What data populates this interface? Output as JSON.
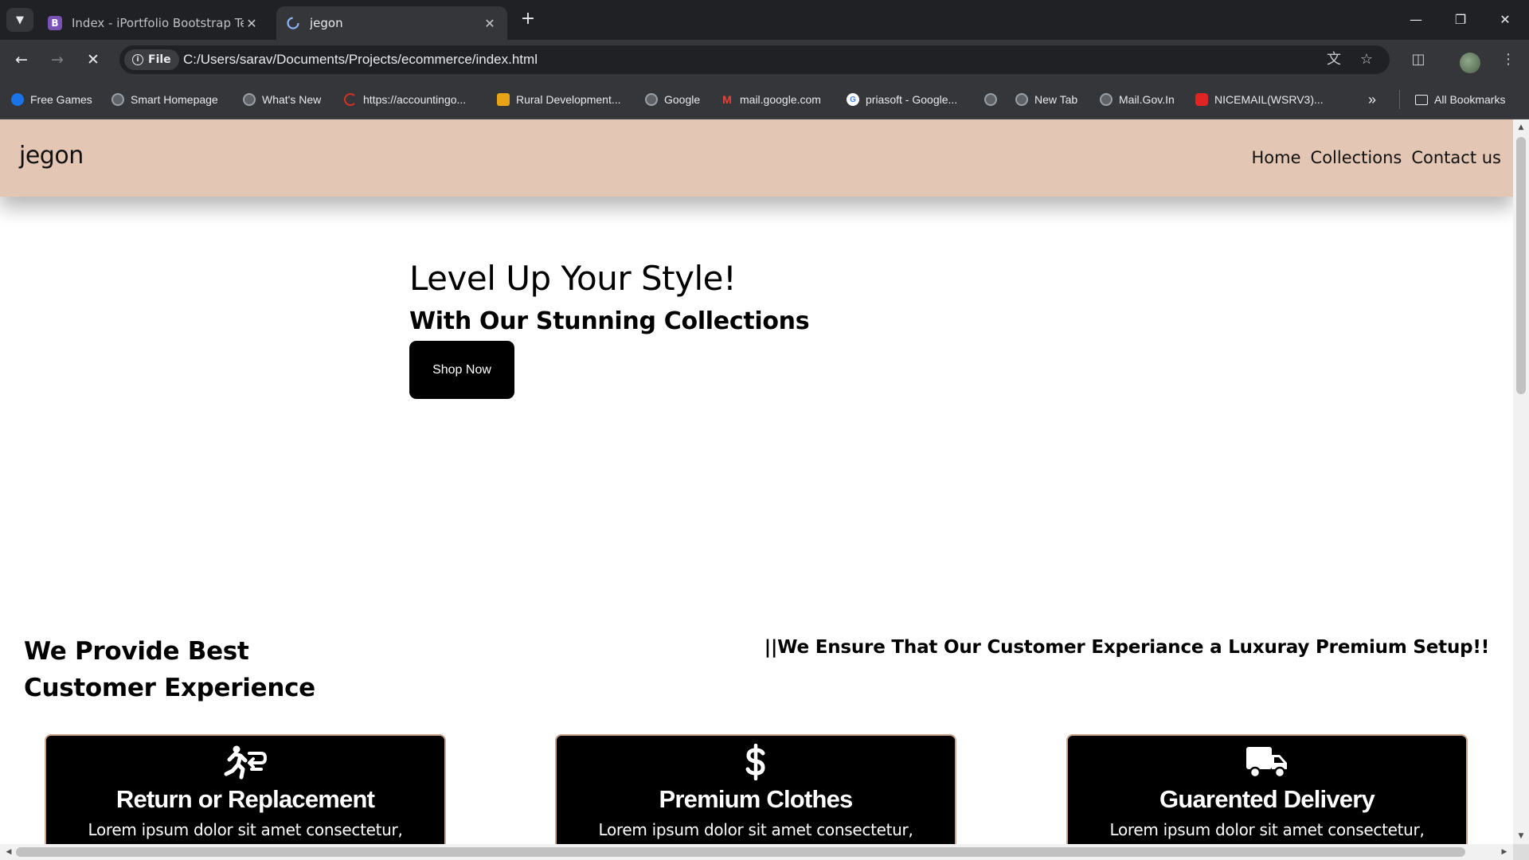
{
  "browser": {
    "tabs": [
      {
        "title": "Index - iPortfolio Bootstrap Template",
        "favicon": "bootstrap-icon",
        "favicon_letter": "B",
        "favicon_color": "#7952b3",
        "active": false
      },
      {
        "title": "jegon",
        "favicon": "loading-icon",
        "active": true
      }
    ],
    "omnibox": {
      "chip": "File",
      "url": "C:/Users/sarav/Documents/Projects/ecommerce/index.html"
    },
    "bookmarks": [
      {
        "label": "Free Games",
        "icon": "free-games-icon"
      },
      {
        "label": "Smart Homepage",
        "icon": "globe-icon"
      },
      {
        "label": "What's New",
        "icon": "globe-icon"
      },
      {
        "label": "https://accountingo...",
        "icon": "accounting-icon"
      },
      {
        "label": "Rural Development...",
        "icon": "rural-icon"
      },
      {
        "label": "Google",
        "icon": "globe-icon"
      },
      {
        "label": "mail.google.com",
        "icon": "gmail-icon"
      },
      {
        "label": "priasoft - Google...",
        "icon": "google-icon"
      },
      {
        "label": "",
        "icon": "globe-icon"
      },
      {
        "label": "New Tab",
        "icon": "globe-icon"
      },
      {
        "label": "Mail.Gov.In",
        "icon": "globe-icon"
      },
      {
        "label": "NICEMAIL(WSRV3)...",
        "icon": "nicemail-icon"
      }
    ],
    "all_bookmarks": "All Bookmarks"
  },
  "site": {
    "brand": "jegon",
    "nav": [
      "Home",
      "Collections",
      "Contact us"
    ],
    "hero": {
      "title": "Level Up Your Style!",
      "subtitle": "With Our Stunning Collections",
      "cta": "Shop Now"
    },
    "provide_heading": "We Provide Best Customer Experience",
    "ensure_text": "||We Ensure That Our Customer Experiance a Luxuray Premium Setup!!",
    "features": [
      {
        "icon": "return-icon",
        "title": "Return or Replacement",
        "text": "Lorem ipsum dolor sit amet consectetur,"
      },
      {
        "icon": "dollar-icon",
        "title": "Premium Clothes",
        "text": "Lorem ipsum dolor sit amet consectetur,"
      },
      {
        "icon": "truck-icon",
        "title": "Guarented Delivery",
        "text": "Lorem ipsum dolor sit amet consectetur,"
      }
    ]
  },
  "colors": {
    "header_bg": "#e3c6b3",
    "card_bg": "#000000",
    "card_border": "#c9a58f",
    "chrome_dark": "#202124",
    "chrome_toolbar": "#35363a"
  }
}
